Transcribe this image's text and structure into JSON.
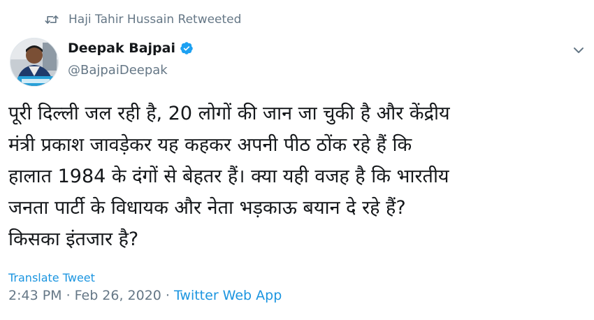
{
  "retweet": {
    "icon": "retweet-icon",
    "label": "Haji Tahir Hussain Retweeted"
  },
  "author": {
    "name": "Deepak Bajpai",
    "handle": "@BajpaiDeepak",
    "verified_icon": "verified-badge-icon"
  },
  "menu_icon": "chevron-down-icon",
  "tweet": {
    "text": "पूरी दिल्ली जल रही है, 20 लोगों की जान जा चुकी है और केंद्रीय\nमंत्री प्रकाश जावड़ेकर यह कहकर अपनी पीठ ठोंक रहे हैं कि\nहालात 1984 के दंगों से बेहतर हैं। क्या यही वजह है कि भारतीय\nजनता पार्टी के विधायक और नेता भड़काऊ बयान दे रहे हैं?\nकिसका इंतजार है?"
  },
  "translate_label": "Translate Tweet",
  "meta": {
    "time": "2:43 PM",
    "separator": "·",
    "date": "Feb 26, 2020",
    "source": "Twitter Web App"
  },
  "colors": {
    "link": "#1b95e0",
    "muted": "#657786",
    "text": "#14171a"
  }
}
